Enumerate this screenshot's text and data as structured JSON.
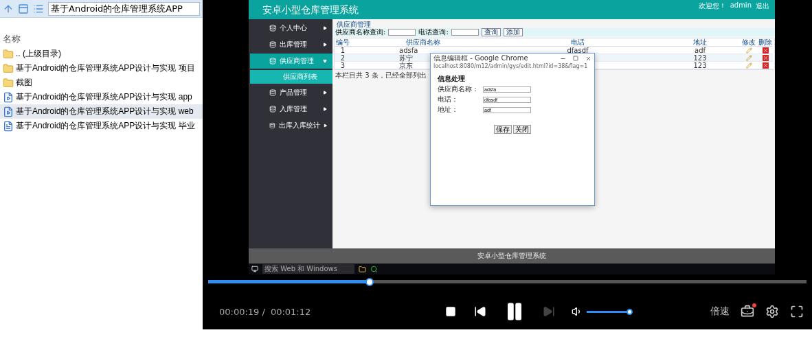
{
  "explorer": {
    "address": "基于Android的仓库管理系统APP",
    "column": "名称",
    "items": [
      {
        "kind": "folder",
        "name": ".. (上级目录)",
        "selected": false
      },
      {
        "kind": "folder",
        "name": "基于Android的仓库管理系统APP设计与实现 项目",
        "selected": false
      },
      {
        "kind": "folder",
        "name": "截图",
        "selected": false
      },
      {
        "kind": "mp4",
        "name": "基于Android的仓库管理系统APP设计与实现 app",
        "selected": false
      },
      {
        "kind": "avi",
        "name": "基于Android的仓库管理系统APP设计与实现 web",
        "selected": true
      },
      {
        "kind": "doc",
        "name": "基于Android的仓库管理系统APP设计与实现 毕业",
        "selected": false
      }
    ]
  },
  "app": {
    "title": "安卓小型仓库管理系统",
    "welcome": "欢迎您！",
    "user": "admin",
    "logout": "退出",
    "sidebar": [
      {
        "label": "个人中心",
        "selected": false,
        "expanded": false
      },
      {
        "label": "出库管理",
        "selected": false,
        "expanded": false
      },
      {
        "label": "供应商管理",
        "selected": true,
        "expanded": true,
        "children": [
          {
            "label": "供应商列表"
          }
        ]
      },
      {
        "label": "产品管理",
        "selected": false,
        "expanded": false
      },
      {
        "label": "入库管理",
        "selected": false,
        "expanded": false
      },
      {
        "label": "出库入库统计",
        "selected": false,
        "expanded": false
      }
    ],
    "breadcrumb": "供应商管理",
    "search": [
      {
        "label": "供应商名称查询:"
      },
      {
        "label": "电话查询:"
      }
    ],
    "search_buttons": [
      "查询",
      "添加"
    ],
    "table": {
      "columns": [
        "编号",
        "供应商名称",
        "电话",
        "地址",
        "修改",
        "删除"
      ],
      "rows": [
        {
          "id": "1",
          "name": "adsfa",
          "phone": "dfasdf",
          "address": "adf"
        },
        {
          "id": "2",
          "name": "苏宁",
          "address": "123"
        },
        {
          "id": "3",
          "name": "京东",
          "address": "123"
        }
      ]
    },
    "status": "本栏目共 3 条，已经全部列出",
    "footer": "安卓小型仓库管理系统",
    "dialog": {
      "title": "信息编辑框 - Google Chrome",
      "url": "localhost:8080/m12/admin/gys/edit.html?id=38&flag=1",
      "heading": "信息处理",
      "fields": [
        {
          "label": "供应商名称：",
          "value": "adsfa"
        },
        {
          "label": "电话：",
          "value": "dfasdf"
        },
        {
          "label": "地址：",
          "value": "adf"
        }
      ],
      "buttons": [
        "保存",
        "关闭"
      ]
    },
    "taskbar": {
      "search": "搜索 Web 和 Windows"
    }
  },
  "player": {
    "progress": {
      "level": 0.27
    },
    "elapsed": "00:00:19 /",
    "total": "00:01:12",
    "buttons": [
      {
        "kind": "stop",
        "disabled": false
      },
      {
        "kind": "prev",
        "disabled": false
      },
      {
        "kind": "pause",
        "disabled": false
      },
      {
        "kind": "next",
        "disabled": true
      }
    ],
    "volume": {
      "level": 1
    },
    "speed": "倍速"
  }
}
